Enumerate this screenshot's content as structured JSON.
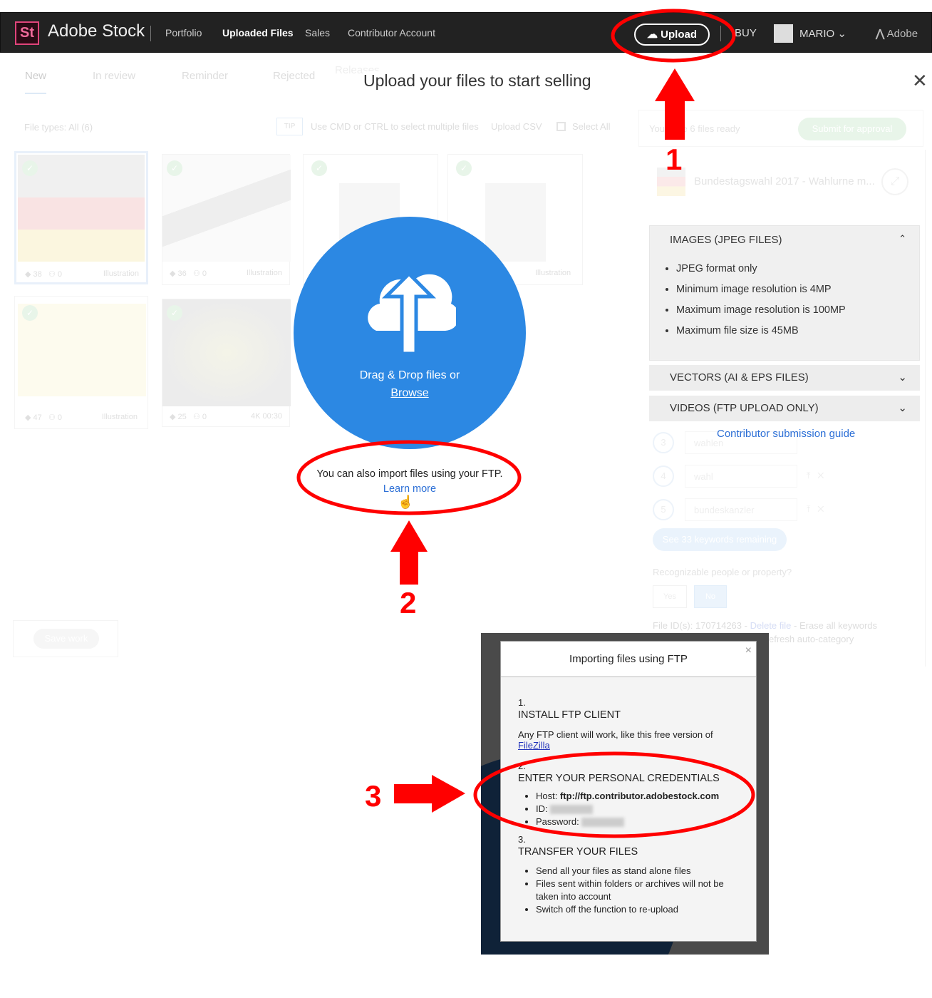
{
  "nav": {
    "logo": "St",
    "brand": "Adobe Stock",
    "links": [
      "Portfolio",
      "Uploaded Files",
      "Sales",
      "Contributor Account"
    ],
    "upload": "Upload",
    "buy": "BUY",
    "user": "MARIO",
    "adobe": "Adobe"
  },
  "tabs": [
    "New",
    "In review",
    "Reminder",
    "Rejected",
    "Releases"
  ],
  "overlay": {
    "title": "Upload your files to start selling",
    "drop": "Drag & Drop files or",
    "browse": "Browse",
    "ftp_text": "You can also import files using your FTP.",
    "learn_more": "Learn more"
  },
  "toolbar": {
    "file_types": "File types: All (6)",
    "tip": "TIP",
    "tip_text": "Use CMD or CTRL to select multiple files",
    "upload_csv": "Upload CSV",
    "select_all": "Select All"
  },
  "files": [
    {
      "keywords": "38",
      "people": "0",
      "type": "Illustration"
    },
    {
      "keywords": "36",
      "people": "0",
      "type": "Illustration"
    },
    {
      "keywords": "",
      "people": "",
      "type": ""
    },
    {
      "keywords": "",
      "people": "",
      "type": "Illustration"
    },
    {
      "keywords": "47",
      "people": "0",
      "type": "Illustration"
    },
    {
      "keywords": "25",
      "people": "0",
      "type": "4K 00:30"
    }
  ],
  "save_work": "Save work",
  "right": {
    "ready": "You have 6 files ready",
    "submit": "Submit for approval",
    "file_title": "Bundestagswahl 2017 - Wahlurne m...",
    "images_header": "IMAGES (JPEG FILES)",
    "images_rules": [
      "JPEG format only",
      "Minimum image resolution is 4MP",
      "Maximum image resolution is 100MP",
      "Maximum file size is 45MB"
    ],
    "vectors_header": "VECTORS (AI & EPS FILES)",
    "videos_header": "VIDEOS (FTP UPLOAD ONLY)",
    "guide": "Contributor submission guide",
    "keywords": [
      {
        "n": "3",
        "k": "wahlen"
      },
      {
        "n": "4",
        "k": "wahl"
      },
      {
        "n": "5",
        "k": "bundeskanzler"
      }
    ],
    "see_more": "See 33 keywords remaining",
    "recognizable": "Recognizable people or property?",
    "yes": "Yes",
    "no": "No",
    "file_id": "File ID(s): 170714263 - ",
    "delete": "Delete file",
    "erase": " - Erase all keywords",
    "refresh": "efresh auto-category"
  },
  "ftp_dialog": {
    "title": "Importing files using FTP",
    "close": "×",
    "step1_num": "1.",
    "step1_title": "INSTALL FTP CLIENT",
    "step1_text": "Any FTP client will work, like this free version of ",
    "filezilla": "FileZilla",
    "step2_num": "2.",
    "step2_title": "ENTER YOUR PERSONAL CREDENTIALS",
    "host_label": "Host: ",
    "host": "ftp://ftp.contributor.adobestock.com",
    "id_label": "ID: ",
    "password_label": "Password: ",
    "step3_num": "3.",
    "step3_title": "TRANSFER YOUR FILES",
    "step3_items": [
      "Send all your files as stand alone files",
      "Files sent within folders or archives will not be taken into account",
      "Switch off the function to re-upload"
    ]
  },
  "annotations": [
    "1",
    "2",
    "3"
  ],
  "colors": {
    "accent": "#2c88e3",
    "annotation": "#ff0000",
    "nav": "#222222"
  }
}
